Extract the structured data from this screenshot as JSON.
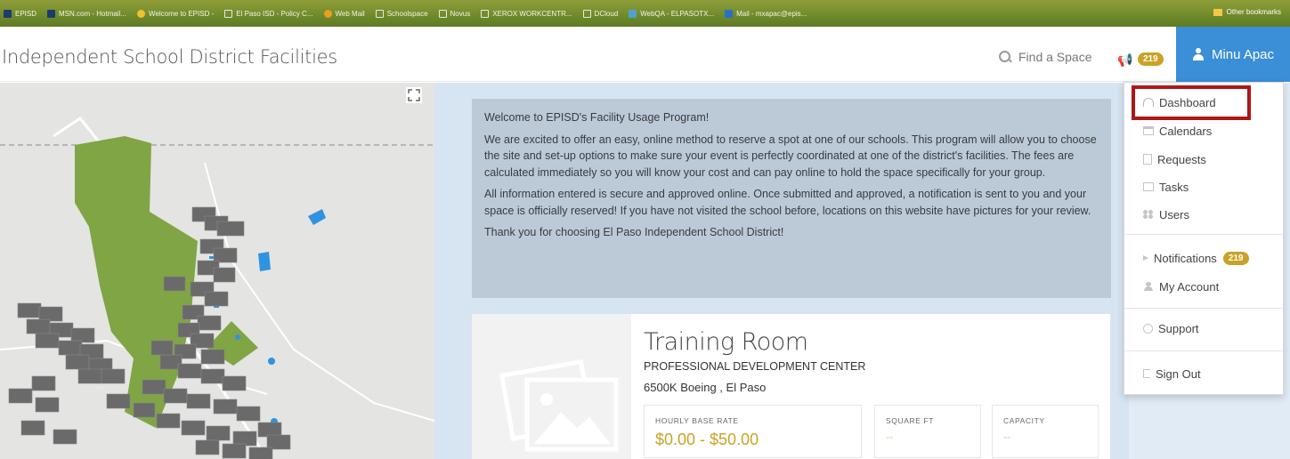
{
  "bookmarks": [
    {
      "label": "EPISD",
      "icon": "episd-icon"
    },
    {
      "label": "MSN.com - Hotmail...",
      "icon": "msn-icon"
    },
    {
      "label": "Welcome to EPISD -",
      "icon": "globe-icon"
    },
    {
      "label": "El Paso ISD - Policy C...",
      "icon": "page-icon"
    },
    {
      "label": "Web Mail",
      "icon": "webmail-icon"
    },
    {
      "label": "Schoolspace",
      "icon": "page-icon"
    },
    {
      "label": "Novus",
      "icon": "page-icon"
    },
    {
      "label": "XEROX WORKCENTR...",
      "icon": "page-icon"
    },
    {
      "label": "DCloud",
      "icon": "page-icon"
    },
    {
      "label": "WebQA - ELPASOTX...",
      "icon": "webqa-icon"
    },
    {
      "label": "Mail - mxapac@epis...",
      "icon": "mail-icon"
    }
  ],
  "other_bookmarks": "Other bookmarks",
  "header": {
    "site_title": "Independent School District Facilities",
    "find_space": "Find a Space",
    "notification_count": "219",
    "user_name": "Minu Apac"
  },
  "welcome": {
    "heading": "Welcome to EPISD's Facility Usage Program!",
    "paragraph1": "We are excited to offer an easy, online method to reserve a spot at one of our schools.  This program will allow you to choose the site and set-up options to make sure your event is perfectly coordinated at one of the district's facilities.  The fees are calculated immediately so you will know your cost and can pay online to hold the space specifically for your group.",
    "paragraph2": "All information entered is secure and approved online.  Once submitted and approved, a notification is sent to you and your space is officially reserved!  If you have not visited the school before, locations on this website have pictures for your review.",
    "paragraph3": "Thank you for choosing El Paso Independent School District!"
  },
  "card": {
    "title": "Training Room",
    "subtitle": "PROFESSIONAL DEVELOPMENT CENTER",
    "address": "6500K Boeing , El Paso",
    "rate_label": "HOURLY BASE RATE",
    "rate_value": "$0.00 - $50.00",
    "sqft_label": "SQUARE FT",
    "sqft_value": "--",
    "capacity_label": "CAPACITY",
    "capacity_value": "--"
  },
  "menu": {
    "dashboard": "Dashboard",
    "calendars": "Calendars",
    "requests": "Requests",
    "tasks": "Tasks",
    "users": "Users",
    "notifications": "Notifications",
    "notifications_count": "219",
    "my_account": "My Account",
    "support": "Support",
    "sign_out": "Sign Out"
  },
  "colors": {
    "accent": "#3b8fd6",
    "badge": "#c9a227",
    "highlight": "#b01515",
    "map_green": "#7fa544"
  }
}
